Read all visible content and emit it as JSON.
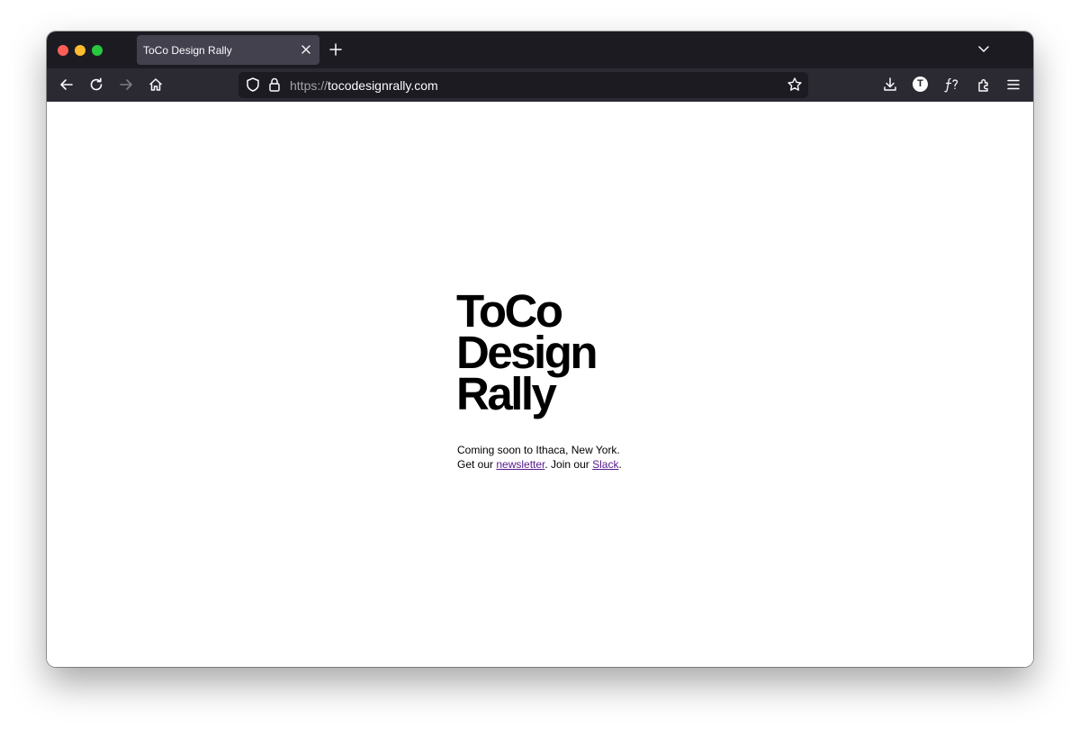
{
  "browser": {
    "tab": {
      "title": "ToCo Design Rally"
    },
    "url": {
      "scheme": "https://",
      "host": "tocodesignrally.com"
    },
    "account_initial": "T",
    "colors": {
      "chrome_dark": "#1c1b22",
      "toolbar": "#2b2a33",
      "tab_active": "#42414d"
    }
  },
  "page": {
    "title_lines": [
      "ToCo",
      "Design",
      "Rally"
    ],
    "line1": "Coming soon to Ithaca, New York.",
    "line2_prefix": "Get our ",
    "newsletter_link": "newsletter",
    "line2_middle": ". Join our ",
    "slack_link": "Slack",
    "line2_suffix": ".",
    "link_color": "#551a8b"
  }
}
